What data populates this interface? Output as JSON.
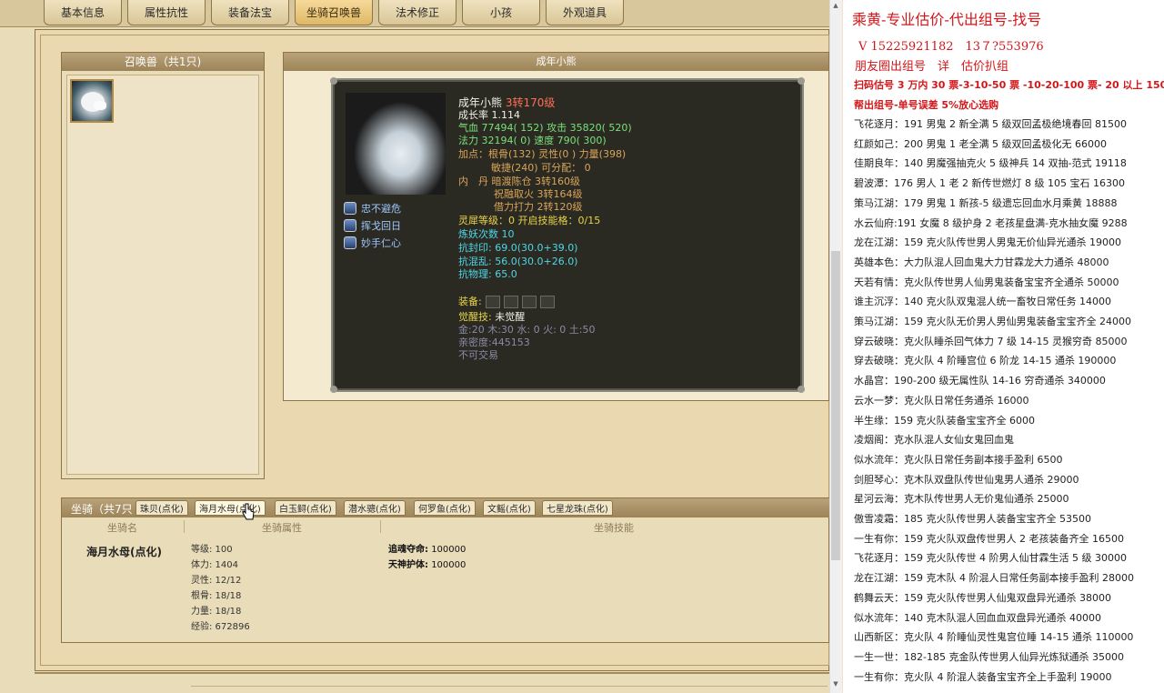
{
  "tabs": [
    "基本信息",
    "属性抗性",
    "装备法宝",
    "坐骑召唤兽",
    "法术修正",
    "小孩",
    "外观道具"
  ],
  "active_tab": "坐骑召唤兽",
  "summon_panel": {
    "title": "召唤兽（共1只)"
  },
  "detail_panel": {
    "title": "成年小熊"
  },
  "pet": {
    "name": "成年小熊",
    "level": "3转170级",
    "growth": "成长率 1.114",
    "hp_label": "气血",
    "hp": "77494( 152)",
    "atk_label": "攻击",
    "atk": "35820( 520)",
    "mp_label": "法力",
    "mp": "32194( 0)",
    "spd_label": "速度",
    "spd": "790( 300)",
    "points": "加点：根骨(132) 灵性(0 ) 力量(398)",
    "points2": "敏捷(240) 可分配： 0",
    "neidan_label": "内　丹",
    "neidan1": "暗渡陈仓 3转160级",
    "neidan2": "祝融取火 3转164级",
    "neidan3": "借力打力 2转120级",
    "lingxi": "灵犀等级：0 开启技能格：0/15",
    "lianyao": "炼妖次数 10",
    "kangfeng": "抗封印: 69.0(30.0+39.0)",
    "kanghun": "抗混乱: 56.0(30.0+26.0)",
    "kangwuli": "抗物理: 65.0",
    "equip_label": "装备:",
    "awaken_label": "觉醒技:",
    "awaken": "未觉醒",
    "elements": "金:20 木:30 水: 0 火: 0 土:50",
    "intimacy": "亲密度:445153",
    "trade": "不可交易",
    "skills": [
      "忠不避危",
      "挥戈回日",
      "妙手仁心"
    ]
  },
  "mounts": {
    "title": "坐骑（共7只",
    "tabs": [
      "珠贝(点化)",
      "海月水母(点化)",
      "白玉鲟(点化)",
      "潜水骢(点化)",
      "何罗鱼(点化)",
      "文鳐(点化)",
      "七星龙珠(点化)"
    ],
    "col_name": "坐骑名",
    "col_attr": "坐骑属性",
    "col_skill": "坐骑技能",
    "name": "海月水母(点化)",
    "attrs": [
      "等级: 100",
      "体力: 1404",
      "灵性: 12/12",
      "根骨: 18/18",
      "力量: 18/18",
      "经验: 672896"
    ],
    "skills": [
      {
        "k": "追魂夺命:",
        "v": "100000"
      },
      {
        "k": "天神护体:",
        "v": "100000"
      }
    ]
  },
  "right": {
    "title": "乘黄-专业估价-代出组号-找号",
    "phone": "V 15225921182　13７?553976",
    "sub": "朋友圈出组号　详　估价扒组",
    "line1": "扫码估号 3 万内 30 票-3-10-50 票 -10-20-100 票- 20 以上 150",
    "line2": "帮出组号-单号误差 5%放心选购",
    "listings": [
      "飞花逐月：191 男鬼 2 新全满 5 级双回孟极绝境春回 81500",
      "红颜如己：200 男鬼 1 老全满 5 级双回孟极化无 66000",
      "佳期良年：140 男魔强抽克火 5 级神兵 14 双抽-范式 19118",
      "碧波潭：176 男人 1 老 2 新传世燃灯 8 级 105 宝石 16300",
      "策马江湖：179 男鬼 1 新孩-5 级遗忘回血水月乘黄 18888",
      "水云仙府:191 女魔 8 级护身 2 老孩星盘满-克水抽女魔 9288",
      "龙在江湖：159 克火队传世男人男鬼无价仙异光通杀 19000",
      "英雄本色：大力队混人回血鬼大力甘霖龙大力通杀 48000",
      "天若有情：克火队传世男人仙男鬼装备宝宝齐全通杀 50000",
      "谁主沉浮：140 克火队双鬼混人统一畜牧日常任务 14000",
      "策马江湖：159 克火队无价男人男仙男鬼装备宝宝齐全 24000",
      "穿云破晓：克火队睡杀回气体力 7 级 14-15 灵猴穷奇 85000",
      "穿去破晓：克火队 4 阶睡宫位 6 阶龙 14-15 通杀 190000",
      "水晶宫：190-200 级无属性队 14-16 穷奇通杀 340000",
      "云水一梦：克火队日常任务通杀 16000",
      "半生缘：159 克火队装备宝宝齐全 6000",
      "凌烟阁：克水队混人女仙女鬼回血鬼",
      "似水流年：克火队日常任务副本接手盈利 6500",
      "剑胆琴心：克木队双盘队传世仙鬼男人通杀 29000",
      "星河云海：克木队传世男人无价鬼仙通杀 25000",
      "傲雪凌霜：185 克火队传世男人装备宝宝齐全 53500",
      "一生有你：159 克火队双盘传世男人 2 老孩装备齐全 16500",
      "飞花逐月：159 克火队传世 4 阶男人仙甘霖生活 5 级 30000",
      "龙在江湖：159 克木队 4 阶混人日常任务副本接手盈利 28000",
      "鹤舞云天：159 克火队传世男人仙鬼双盘异光通杀 38000",
      "似水流年：140 克木队混人回血血双盘异光通杀 40000",
      "山西新区：克火队 4 阶睡仙灵性鬼宫位睡 14-15 通杀 110000",
      "一生一世：182-185 克金队传世男人仙异光炼狱通杀 35000",
      "一生有你：克火队 4 阶混人装备宝宝齐全上手盈利 19000"
    ]
  }
}
